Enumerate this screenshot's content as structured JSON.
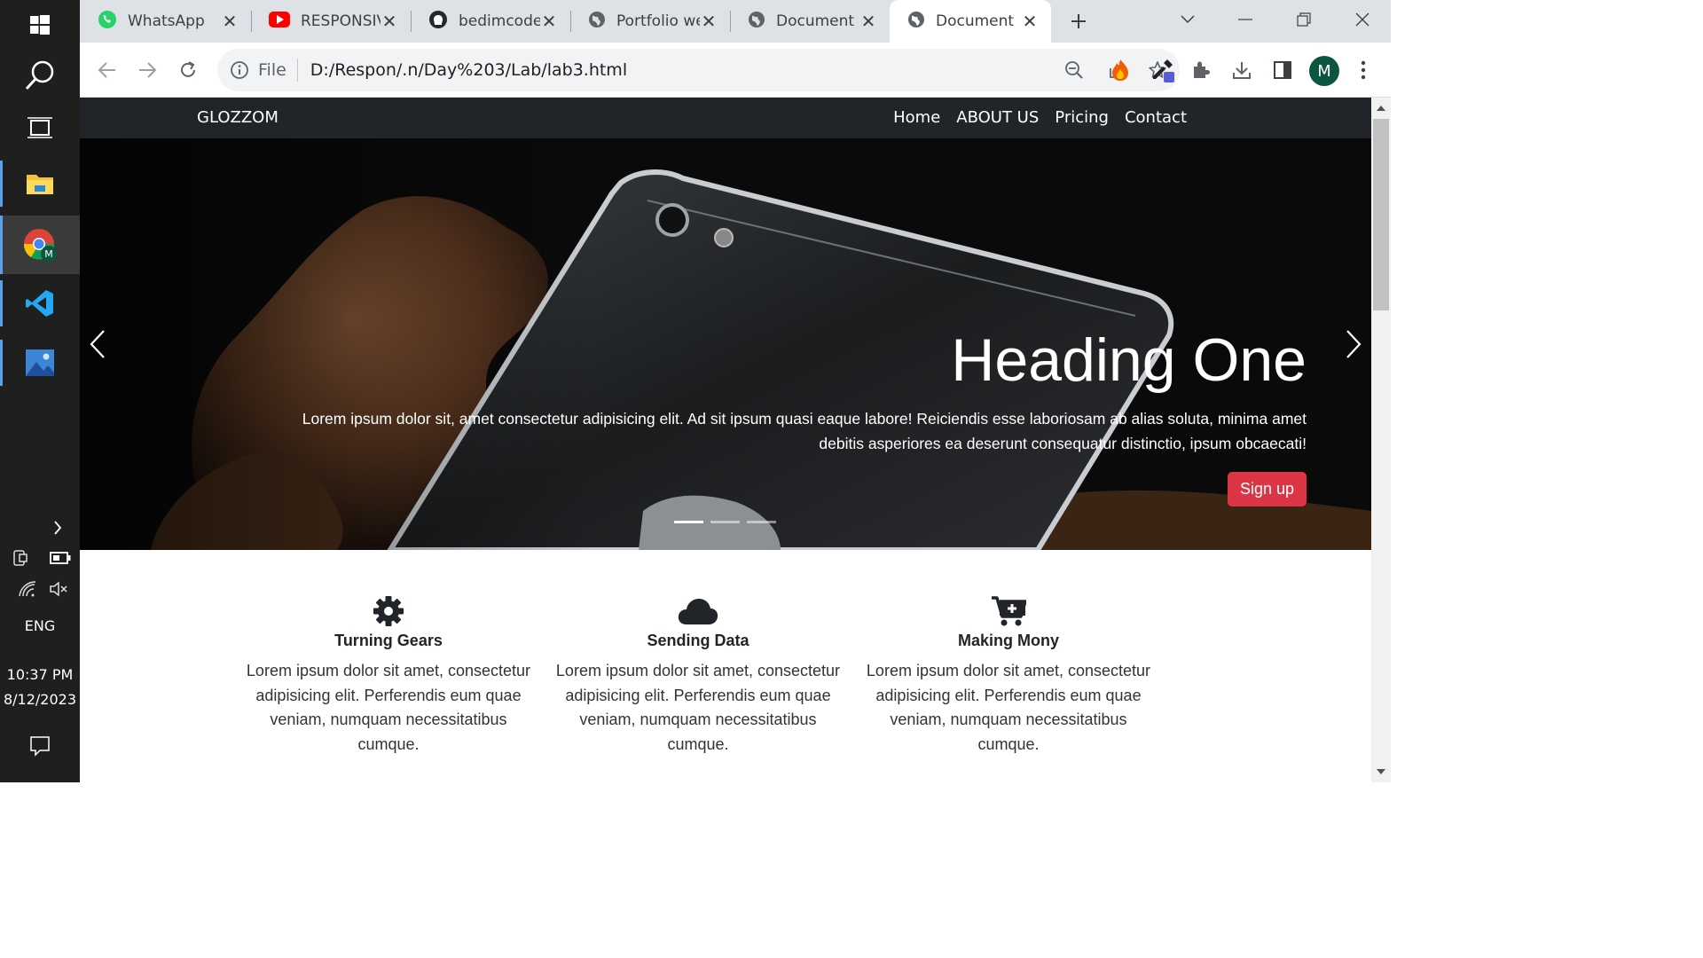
{
  "taskbar": {
    "language": "ENG",
    "time": "10:37 PM",
    "date": "8/12/2023"
  },
  "browser": {
    "tabs": [
      {
        "title": "WhatsApp",
        "icon": "whatsapp-icon"
      },
      {
        "title": "RESPONSIV",
        "icon": "youtube-icon"
      },
      {
        "title": "bedimcode/",
        "icon": "github-icon"
      },
      {
        "title": "Portfolio we",
        "icon": "globe-icon"
      },
      {
        "title": "Document",
        "icon": "globe-icon"
      },
      {
        "title": "Document",
        "icon": "globe-icon",
        "active": true
      }
    ],
    "omnibox": {
      "scheme_label": "File",
      "url": "D:/Respon/.n/Day%203/Lab/lab3.html"
    },
    "profile_initial": "M"
  },
  "site": {
    "brand": "GLOZZOM",
    "nav": [
      "Home",
      "ABOUT US",
      "Pricing",
      "Contact"
    ],
    "hero": {
      "heading": "Heading One",
      "text": "Lorem ipsum dolor sit, amet consectetur adipisicing elit. Ad sit ipsum quasi eaque labore! Reiciendis esse laboriosam ab alias soluta, minima amet debitis asperiores ea deserunt consequatur distinctio, ipsum obcaecati!",
      "button": "Sign up",
      "slides_total": 3,
      "active_slide": 1
    },
    "features": [
      {
        "icon": "gear-icon",
        "title": "Turning Gears",
        "text": "Lorem ipsum dolor sit amet, consectetur adipisicing elit. Perferendis eum quae veniam, numquam necessitatibus cumque."
      },
      {
        "icon": "cloud-icon",
        "title": "Sending Data",
        "text": "Lorem ipsum dolor sit amet, consectetur adipisicing elit. Perferendis eum quae veniam, numquam necessitatibus cumque."
      },
      {
        "icon": "cart-plus-icon",
        "title": "Making Mony",
        "text": "Lorem ipsum dolor sit amet, consectetur adipisicing elit. Perferendis eum quae veniam, numquam necessitatibus cumque."
      }
    ]
  },
  "colors": {
    "navbar": "#212529",
    "signup": "#dc3545",
    "taskbar": "#1f1f1f"
  }
}
